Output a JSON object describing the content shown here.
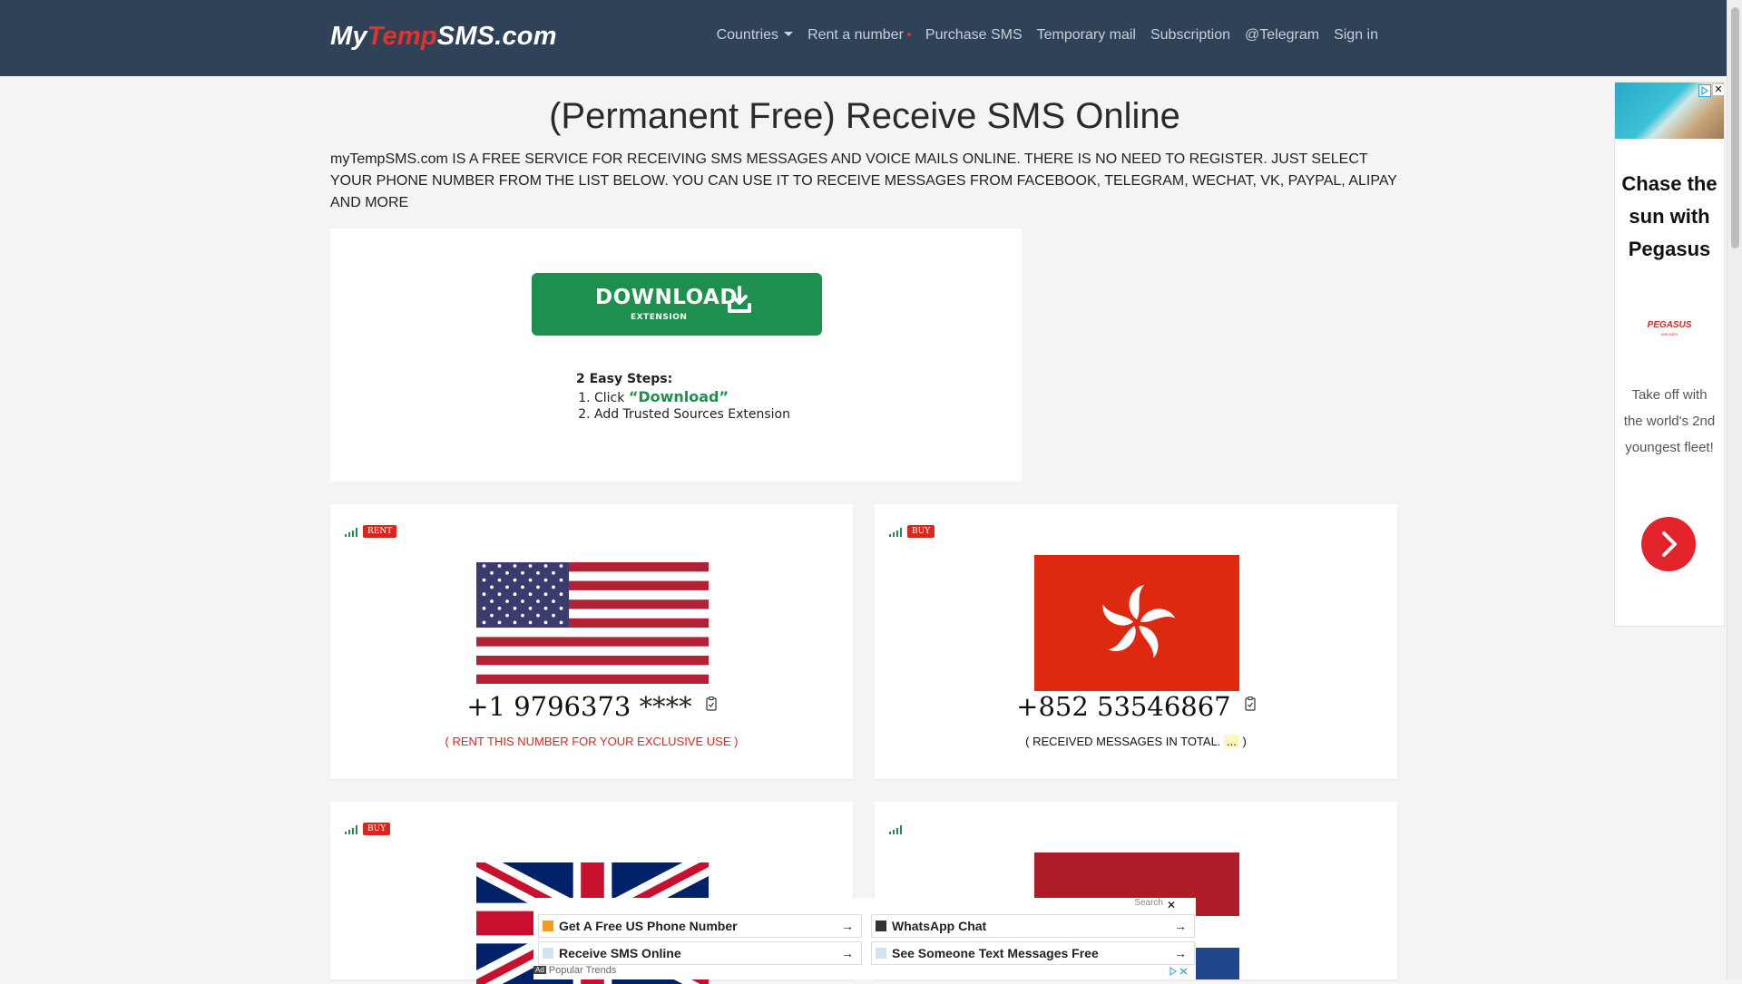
{
  "brand": {
    "part1": "My",
    "part2": "Temp",
    "part3": "SMS.com"
  },
  "nav": {
    "countries": "Countries",
    "rent": "Rent a number",
    "purchase": "Purchase SMS",
    "mail": "Temporary mail",
    "subscription": "Subscription",
    "telegram": "@Telegram",
    "signin": "Sign in"
  },
  "main": {
    "heading": "(Permanent Free) Receive SMS Online",
    "intro": "myTempSMS.com IS A FREE SERVICE FOR RECEIVING SMS MESSAGES AND VOICE MAILS ONLINE. THERE IS NO NEED TO REGISTER. JUST SELECT YOUR PHONE NUMBER FROM THE LIST BELOW. YOU CAN USE IT TO RECEIVE MESSAGES FROM FACEBOOK, TELEGRAM, WECHAT, VK, PAYPAL, ALIPAY AND MORE"
  },
  "download_ad": {
    "button_label": "DOWNLOAD",
    "button_sub": "EXTENSION",
    "steps_title": "2 Easy Steps:",
    "step1_prefix": "Click ",
    "step1_highlight": "“Download”",
    "step2": "Add Trusted Sources Extension"
  },
  "cards": [
    {
      "badge": "RENT",
      "prefix": "+1",
      "number": "9796373",
      "masked": "****",
      "subtitle": "( RENT THIS NUMBER FOR YOUR EXCLUSIVE USE )"
    },
    {
      "badge": "BUY",
      "prefix": "+852",
      "number": "53546867",
      "masked": "",
      "subtitle_prefix": "( RECEIVED MESSAGES IN TOTAL.",
      "subtitle_dots": "...",
      "subtitle_suffix": " )"
    },
    {
      "badge": "BUY"
    },
    {
      "badge": ""
    }
  ],
  "right_ad": {
    "headline": "Chase the sun with Pegasus",
    "logo": "PEGASUS",
    "logo_sub": "AIRLINES",
    "body": "Take off with the world's 2nd youngest fleet!"
  },
  "bottom_ad": {
    "search": "Search",
    "items": [
      "Get A Free US Phone Number",
      "WhatsApp Chat",
      "Receive SMS Online",
      "See Someone Text Messages Free"
    ],
    "footer_ad": "Ad",
    "footer_text": "Popular Trends"
  },
  "colors": {
    "nav_bg": "#2f4257",
    "accent_red": "#d9271d",
    "download_green": "#1f8f4d"
  }
}
